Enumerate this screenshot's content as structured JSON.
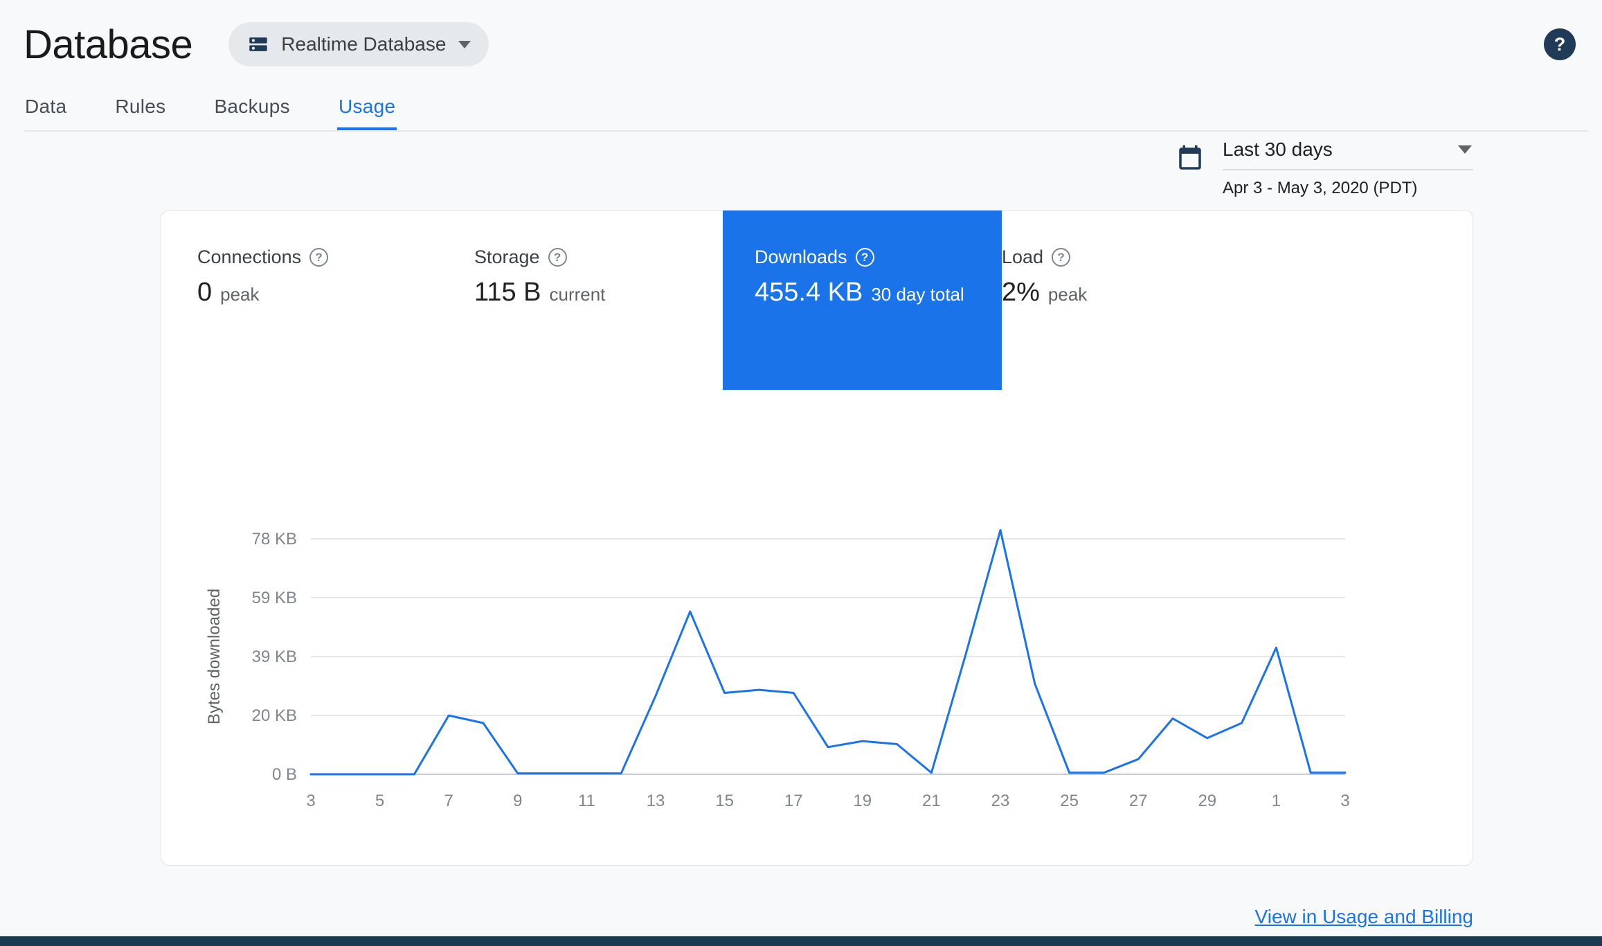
{
  "header": {
    "title": "Database",
    "db_selector_label": "Realtime Database",
    "help_glyph": "?"
  },
  "tabs": [
    {
      "label": "Data",
      "active": false
    },
    {
      "label": "Rules",
      "active": false
    },
    {
      "label": "Backups",
      "active": false
    },
    {
      "label": "Usage",
      "active": true
    }
  ],
  "date_range": {
    "preset": "Last 30 days",
    "range": "Apr 3 - May 3, 2020 (PDT)"
  },
  "metrics": [
    {
      "label": "Connections",
      "value": "0",
      "suffix": "peak",
      "selected": false
    },
    {
      "label": "Storage",
      "value": "115 B",
      "suffix": "current",
      "selected": false
    },
    {
      "label": "Downloads",
      "value": "455.4 KB",
      "suffix": "30 day total",
      "selected": true
    },
    {
      "label": "Load",
      "value": "2%",
      "suffix": "peak",
      "selected": false
    }
  ],
  "chart_data": {
    "type": "line",
    "title": "Bytes downloaded, last 30 days",
    "ylabel": "Bytes downloaded",
    "units": "KB",
    "x_range": "Apr 3 - May 3, 2020",
    "x_tick_labels": [
      "3",
      "5",
      "7",
      "9",
      "11",
      "13",
      "15",
      "17",
      "19",
      "21",
      "23",
      "25",
      "27",
      "29",
      "1",
      "3"
    ],
    "y_tick_labels": [
      "0 B",
      "20 KB",
      "39 KB",
      "59 KB",
      "78 KB"
    ],
    "ylim_kb": [
      0,
      78.1
    ],
    "grid": true,
    "legend": "none",
    "values_kb": [
      0,
      0,
      0,
      0,
      19.5,
      17,
      0.3,
      0.3,
      0.3,
      0.3,
      26,
      54,
      27,
      28,
      27,
      9,
      11,
      10,
      0.5,
      40,
      81,
      30,
      0.5,
      0.5,
      5,
      18.5,
      12,
      17,
      42,
      0.5,
      0.5
    ]
  },
  "footer": {
    "link_label": "View in Usage and Billing"
  },
  "colors": {
    "accent": "#1a73e8",
    "selected_tile_bg": "#1a73e8",
    "dark_icon": "#1f3b57",
    "grid_line": "#e4e6e9",
    "baseline": "#c9ccd1"
  }
}
